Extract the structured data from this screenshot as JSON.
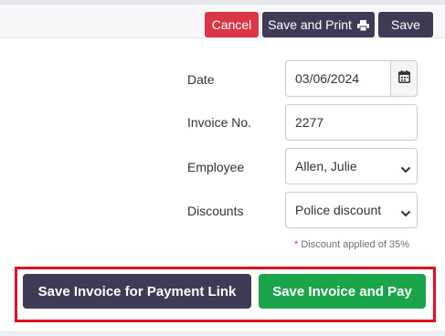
{
  "toolbar": {
    "cancel_label": "Cancel",
    "save_and_print_label": "Save and Print",
    "save_label": "Save"
  },
  "form": {
    "date": {
      "label": "Date",
      "value": "03/06/2024"
    },
    "invoice_no": {
      "label": "Invoice No.",
      "value": "2277"
    },
    "employee": {
      "label": "Employee",
      "value": "Allen, Julie"
    },
    "discounts": {
      "label": "Discounts",
      "value": "Police discount"
    },
    "discount_note_star": "*",
    "discount_note": "Discount applied of 35%"
  },
  "actions": {
    "payment_link_label": "Save Invoice for Payment Link",
    "invoice_and_pay_label": "Save Invoice and Pay"
  },
  "colors": {
    "danger": "#dc3545",
    "primary_dark": "#3d3b55",
    "success": "#1aa54a",
    "highlight": "#e0111d"
  },
  "icons": [
    "printer-icon",
    "calendar-icon",
    "chevron-down-icon"
  ]
}
